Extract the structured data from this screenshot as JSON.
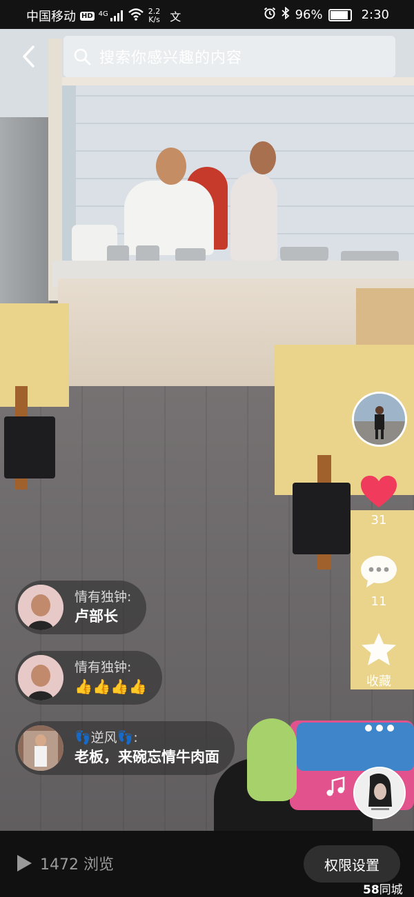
{
  "status_bar": {
    "carrier": "中国移动",
    "hd_badge": "HD",
    "network": "4G",
    "speed_value": "2.2",
    "speed_unit": "K/s",
    "extra_icon_char": "文",
    "battery_percent": "96%",
    "battery_level": 0.96,
    "time": "2:30"
  },
  "header": {
    "search_placeholder": "搜索你感兴趣的内容"
  },
  "right_rail": {
    "like_count": "31",
    "comment_count": "11",
    "favorite_label": "收藏",
    "like_color": "#f03b5c"
  },
  "comments": [
    {
      "user": "情有独钟:",
      "text": "卢部长"
    },
    {
      "user": "情有独钟:",
      "text": "👍👍👍👍"
    },
    {
      "user": "👣逆风👣:",
      "text": "老板，来碗忘情牛肉面"
    }
  ],
  "bottom_bar": {
    "view_count": "1472 浏览",
    "permission_button": "权限设置",
    "brand_logo": "58",
    "brand_name": "同城"
  }
}
